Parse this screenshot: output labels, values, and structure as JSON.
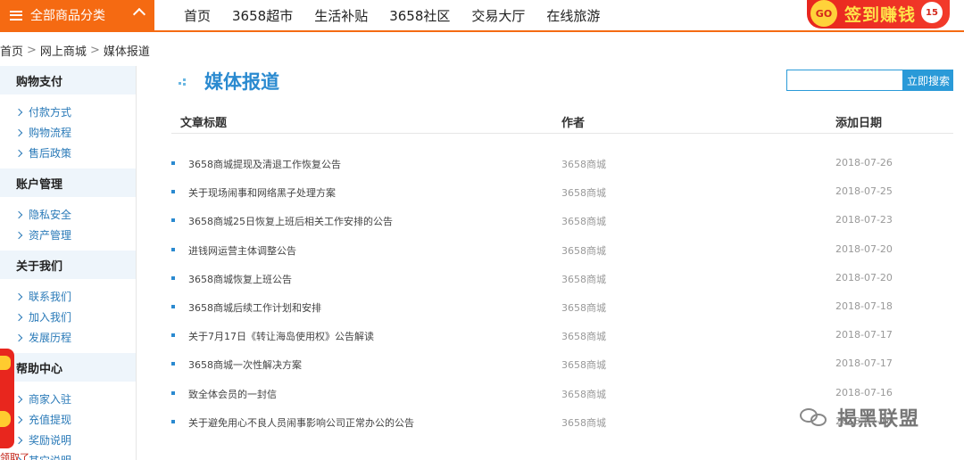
{
  "topbar": {
    "category_label": "全部商品分类",
    "nav_items": [
      "首页",
      "3658超市",
      "生活补贴",
      "3658社区",
      "交易大厅",
      "在线旅游"
    ],
    "signin": {
      "go": "GO",
      "label": "签到赚钱",
      "badge": "15"
    }
  },
  "breadcrumb": [
    "首页",
    "网上商城",
    "媒体报道"
  ],
  "sidebar": {
    "sections": [
      {
        "title": "购物支付",
        "items": [
          "付款方式",
          "购物流程",
          "售后政策"
        ]
      },
      {
        "title": "账户管理",
        "items": [
          "隐私安全",
          "资产管理"
        ]
      },
      {
        "title": "关于我们",
        "items": [
          "联系我们",
          "加入我们",
          "发展历程"
        ]
      },
      {
        "title": "帮助中心",
        "items": [
          "商家入驻",
          "充值提现",
          "奖励说明",
          "其它说明"
        ]
      }
    ]
  },
  "float": {
    "text": "领取了"
  },
  "main": {
    "title": "媒体报道",
    "search": {
      "value": "",
      "button_label": "立即搜索"
    },
    "columns": {
      "title": "文章标题",
      "author": "作者",
      "date": "添加日期"
    },
    "rows": [
      {
        "title": "3658商城提现及清退工作恢复公告",
        "author": "3658商城",
        "date": "2018-07-26"
      },
      {
        "title": "关于现场闹事和网络黑子处理方案",
        "author": "3658商城",
        "date": "2018-07-25"
      },
      {
        "title": "3658商城25日恢复上班后相关工作安排的公告",
        "author": "3658商城",
        "date": "2018-07-23"
      },
      {
        "title": "进钱网运营主体调整公告",
        "author": "3658商城",
        "date": "2018-07-20"
      },
      {
        "title": "3658商城恢复上班公告",
        "author": "3658商城",
        "date": "2018-07-20"
      },
      {
        "title": "3658商城后续工作计划和安排",
        "author": "3658商城",
        "date": "2018-07-18"
      },
      {
        "title": "关于7月17日《转让海岛使用权》公告解读",
        "author": "3658商城",
        "date": "2018-07-17"
      },
      {
        "title": "3658商城一次性解决方案",
        "author": "3658商城",
        "date": "2018-07-17"
      },
      {
        "title": "致全体会员的一封信",
        "author": "3658商城",
        "date": "2018-07-16"
      },
      {
        "title": "关于避免用心不良人员闹事影响公司正常办公的公告",
        "author": "3658商城",
        "date": "2018-07-16"
      }
    ]
  },
  "watermark": "揭黑联盟"
}
